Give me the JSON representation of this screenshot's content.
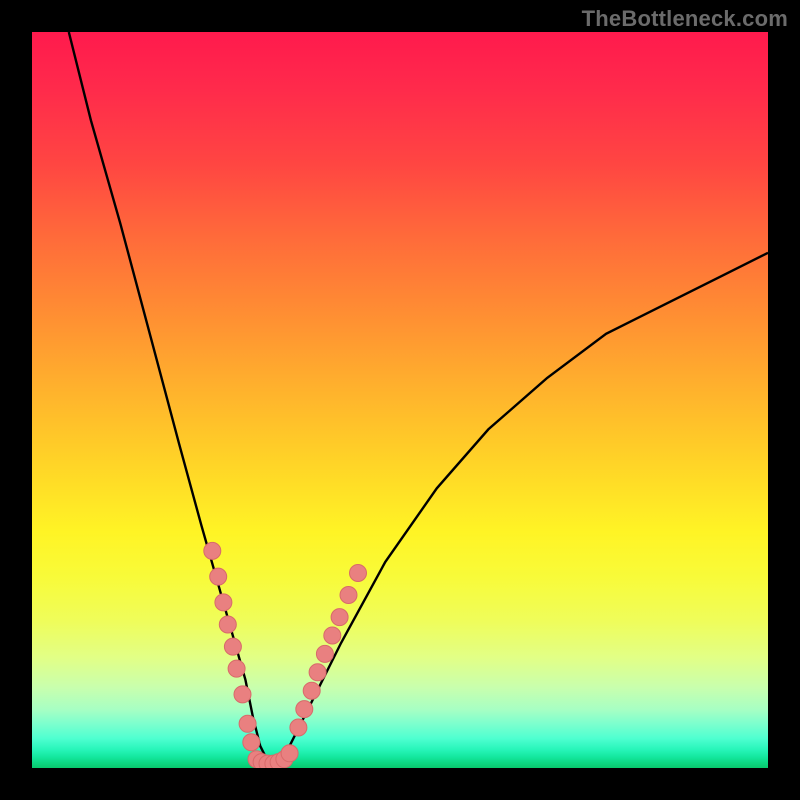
{
  "watermark": "TheBottleneck.com",
  "colors": {
    "frame": "#000000",
    "curve": "#000000",
    "marker_fill": "#e98080",
    "marker_stroke": "#d86a6a",
    "gradient_top": "#ff1a4d",
    "gradient_bottom": "#09c86d"
  },
  "chart_data": {
    "type": "line",
    "title": "",
    "xlabel": "",
    "ylabel": "",
    "xlim": [
      0,
      100
    ],
    "ylim": [
      0,
      100
    ],
    "grid": false,
    "legend": false,
    "series": [
      {
        "name": "bottleneck-curve",
        "x": [
          5,
          8,
          12,
          16,
          20,
          23,
          25,
          27,
          29,
          30,
          31,
          32,
          33,
          35,
          38,
          42,
          48,
          55,
          62,
          70,
          78,
          86,
          94,
          100
        ],
        "y": [
          100,
          88,
          74,
          59,
          44,
          33,
          26,
          19,
          12,
          7,
          3,
          1,
          1,
          3,
          9,
          17,
          28,
          38,
          46,
          53,
          59,
          63,
          67,
          70
        ]
      }
    ],
    "points": [
      {
        "name": "left-cluster",
        "x": [
          24.5,
          25.3,
          26.0,
          26.6,
          27.3,
          27.8,
          28.6,
          29.3,
          29.8
        ],
        "y": [
          29.5,
          26.0,
          22.5,
          19.5,
          16.5,
          13.5,
          10.0,
          6.0,
          3.5
        ]
      },
      {
        "name": "bottom-cluster",
        "x": [
          30.5,
          31.2,
          32.0,
          32.8,
          33.5,
          34.3,
          35.0
        ],
        "y": [
          1.2,
          0.8,
          0.6,
          0.6,
          0.8,
          1.2,
          2.0
        ]
      },
      {
        "name": "right-cluster",
        "x": [
          36.2,
          37.0,
          38.0,
          38.8,
          39.8,
          40.8,
          41.8,
          43.0,
          44.3
        ],
        "y": [
          5.5,
          8.0,
          10.5,
          13.0,
          15.5,
          18.0,
          20.5,
          23.5,
          26.5
        ]
      }
    ],
    "annotations": []
  }
}
